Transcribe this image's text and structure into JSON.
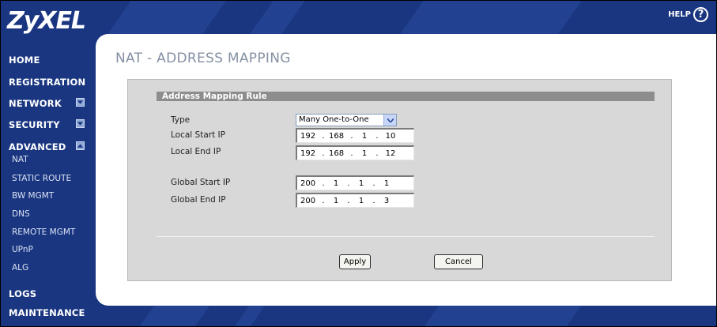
{
  "app": {
    "logo": "ZyXEL",
    "help_label": "HELP",
    "help_icon": "question-mark-icon"
  },
  "sidebar": {
    "home": "HOME",
    "registration": "REGISTRATION",
    "network": "NETWORK",
    "security": "SECURITY",
    "advanced": "ADVANCED",
    "advanced_items": [
      "NAT",
      "STATIC ROUTE",
      "BW MGMT",
      "DNS",
      "REMOTE MGMT",
      "UPnP",
      "ALG"
    ],
    "logs": "LOGS",
    "maintenance": "MAINTENANCE"
  },
  "page": {
    "title": "NAT - ADDRESS MAPPING",
    "section_title": "Address Mapping Rule"
  },
  "form": {
    "type_label": "Type",
    "type_value": "Many One-to-One",
    "local_start_label": "Local Start IP",
    "local_start_ip": [
      "192",
      "168",
      "1",
      "10"
    ],
    "local_end_label": "Local End IP",
    "local_end_ip": [
      "192",
      "168",
      "1",
      "12"
    ],
    "global_start_label": "Global Start IP",
    "global_start_ip": [
      "200",
      "1",
      "1",
      "1"
    ],
    "global_end_label": "Global End IP",
    "global_end_ip": [
      "200",
      "1",
      "1",
      "3"
    ],
    "ip_separator": "."
  },
  "buttons": {
    "apply": "Apply",
    "cancel": "Cancel"
  },
  "colors": {
    "background": "#1a3680",
    "panel": "#ffffff",
    "content_box": "#d8d8d8",
    "section_header": "#8d8d8d",
    "title": "#8590a3"
  }
}
